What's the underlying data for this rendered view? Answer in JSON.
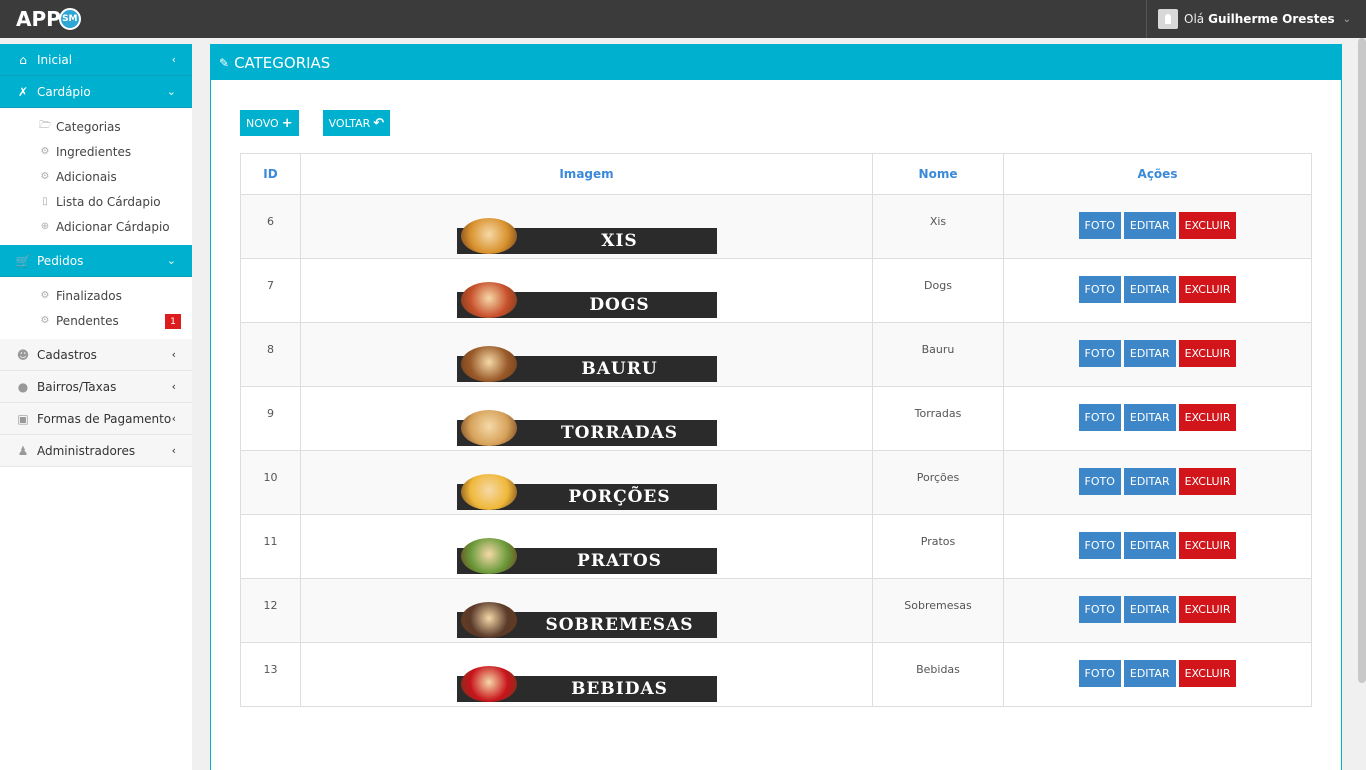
{
  "header": {
    "logo": "APP",
    "logo_badge": "SM",
    "greeting": "Olá",
    "user_name": "Guilherme Orestes"
  },
  "sidebar": {
    "inicial": "Inicial",
    "cardapio": "Cardápio",
    "cardapio_items": [
      "Categorias",
      "Ingredientes",
      "Adicionais",
      "Lista do Cárdapio",
      "Adicionar Cárdapio"
    ],
    "pedidos": "Pedidos",
    "pedidos_items": [
      "Finalizados",
      "Pendentes"
    ],
    "pendentes_badge": "1",
    "cadastros": "Cadastros",
    "bairros": "Bairros/Taxas",
    "formas": "Formas de Pagamento",
    "admins": "Administradores"
  },
  "page": {
    "title": "CATEGORIAS",
    "novo": "NOVO",
    "voltar": "VOLTAR"
  },
  "table": {
    "headers": [
      "ID",
      "Imagem",
      "Nome",
      "Ações"
    ],
    "actions": {
      "foto": "FOTO",
      "editar": "EDITAR",
      "excluir": "EXCLUIR"
    },
    "rows": [
      {
        "id": "6",
        "banner": "XIS",
        "name": "Xis",
        "food_color": "#d9922e"
      },
      {
        "id": "7",
        "banner": "DOGS",
        "name": "Dogs",
        "food_color": "#c8502c"
      },
      {
        "id": "8",
        "banner": "BAURU",
        "name": "Bauru",
        "food_color": "#9a5a2a"
      },
      {
        "id": "9",
        "banner": "TORRADAS",
        "name": "Torradas",
        "food_color": "#d6a25a"
      },
      {
        "id": "10",
        "banner": "PORÇÕES",
        "name": "Porções",
        "food_color": "#f0b83a"
      },
      {
        "id": "11",
        "banner": "PRATOS",
        "name": "Pratos",
        "food_color": "#6a9a3a"
      },
      {
        "id": "12",
        "banner": "SOBREMESAS",
        "name": "Sobremesas",
        "food_color": "#5a3a2a"
      },
      {
        "id": "13",
        "banner": "BEBIDAS",
        "name": "Bebidas",
        "food_color": "#c8141c"
      }
    ]
  }
}
